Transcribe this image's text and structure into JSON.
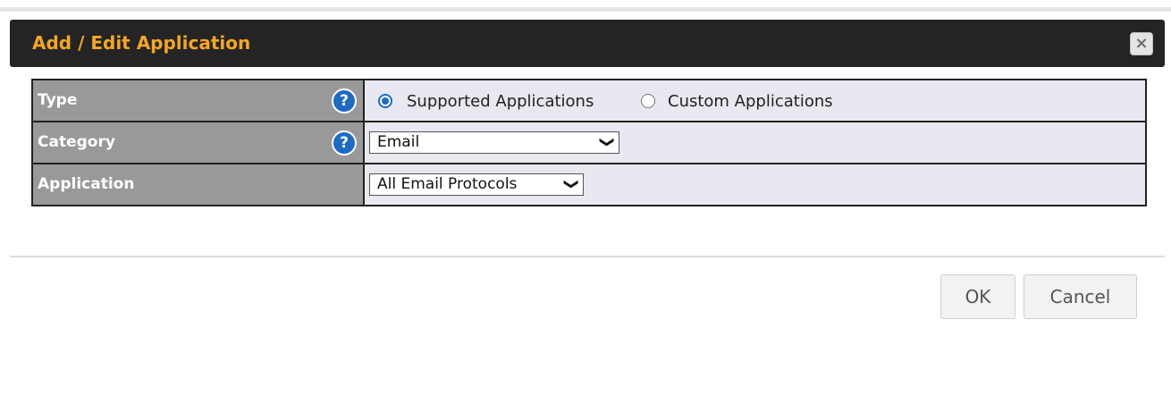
{
  "dialog": {
    "title": "Add / Edit Application",
    "close_symbol": "×"
  },
  "form": {
    "type": {
      "label": "Type",
      "help": "?",
      "options": [
        {
          "label": "Supported Applications",
          "selected": true
        },
        {
          "label": "Custom Applications",
          "selected": false
        }
      ]
    },
    "category": {
      "label": "Category",
      "help": "?",
      "value": "Email"
    },
    "application": {
      "label": "Application",
      "value": "All Email Protocols"
    }
  },
  "buttons": {
    "ok": "OK",
    "cancel": "Cancel"
  },
  "icons": {
    "help": "question-circle-icon",
    "close": "close-icon",
    "chevron": "chevron-down-icon"
  },
  "colors": {
    "title_text": "#f5a623",
    "title_bar": "#242424",
    "label_cell": "#999999",
    "value_cell": "#e8e8f0",
    "help_icon": "#1e6bc6"
  }
}
